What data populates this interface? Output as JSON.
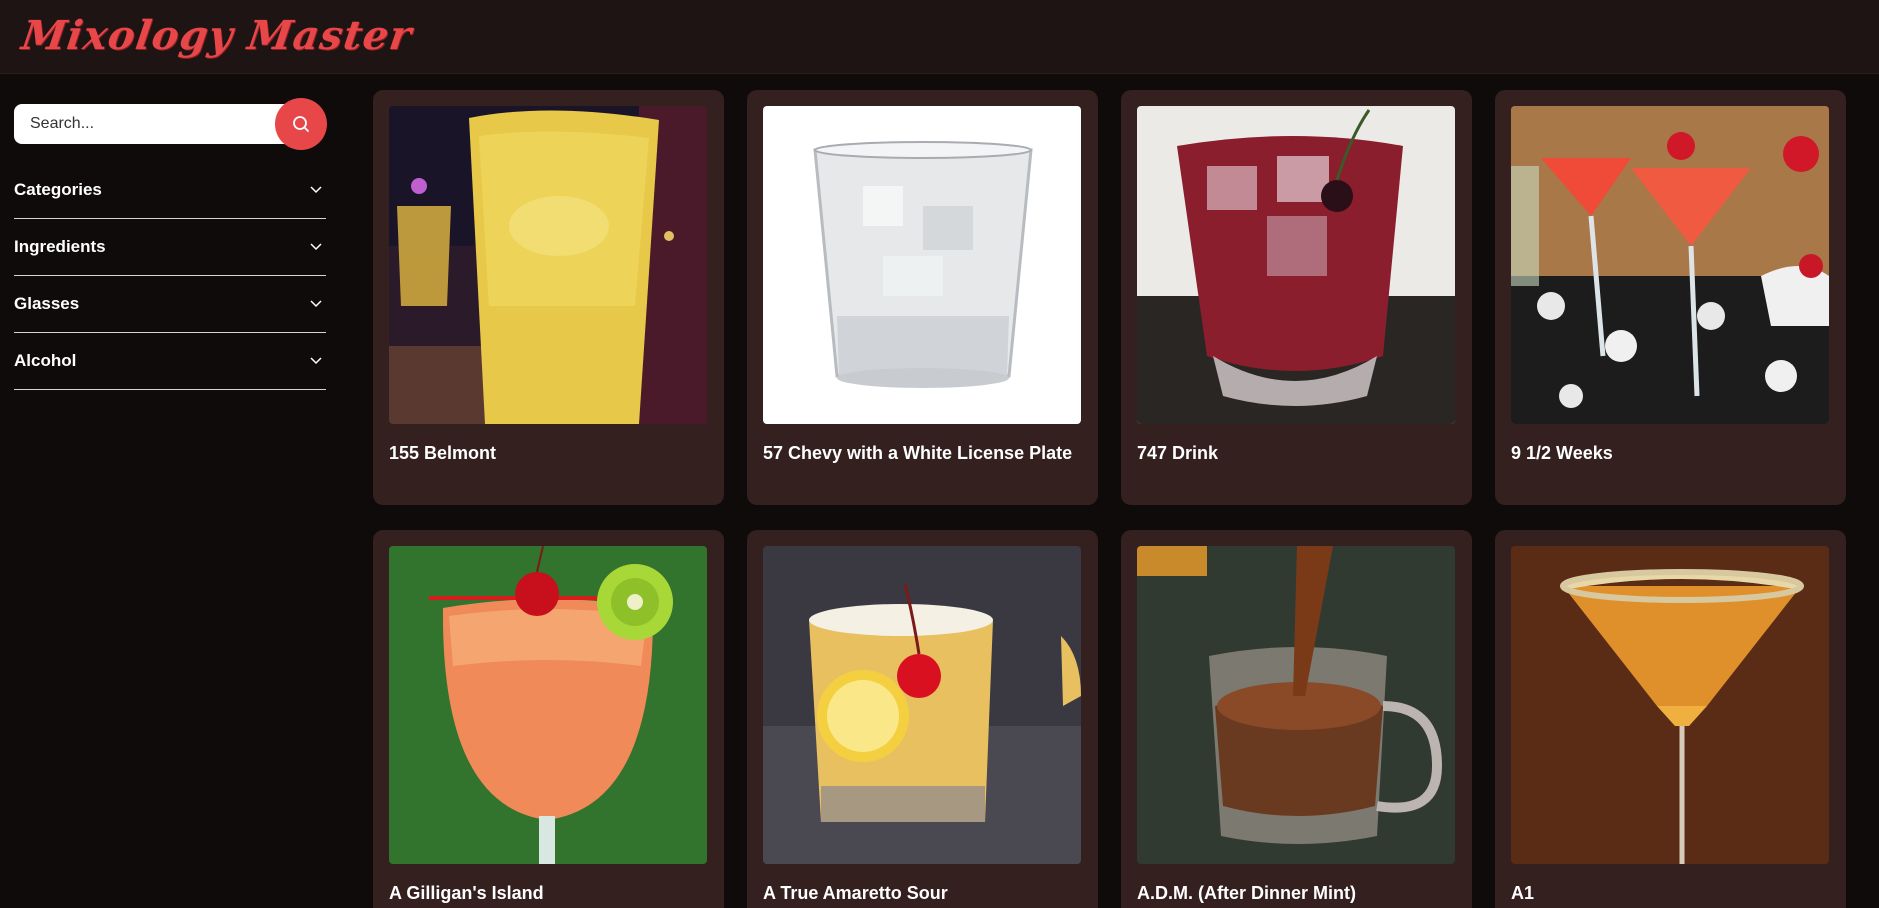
{
  "app": {
    "logo_text": "Mixology Master"
  },
  "search": {
    "placeholder": "Search..."
  },
  "filters": [
    {
      "label": "Categories",
      "icon": "chevron-down-icon"
    },
    {
      "label": "Ingredients",
      "icon": "chevron-down-icon"
    },
    {
      "label": "Glasses",
      "icon": "chevron-down-icon"
    },
    {
      "label": "Alcohol",
      "icon": "chevron-down-icon"
    }
  ],
  "drinks": [
    {
      "name": "155 Belmont"
    },
    {
      "name": "57 Chevy with a White License Plate"
    },
    {
      "name": "747 Drink"
    },
    {
      "name": "9 1/2 Weeks"
    },
    {
      "name": "A Gilligan's Island"
    },
    {
      "name": "A True Amaretto Sour"
    },
    {
      "name": "A.D.M. (After Dinner Mint)"
    },
    {
      "name": "A1"
    }
  ],
  "colors": {
    "accent": "#e8474a",
    "background": "#0f0b0a",
    "topbar": "#1e1414",
    "card": "#33201f"
  }
}
